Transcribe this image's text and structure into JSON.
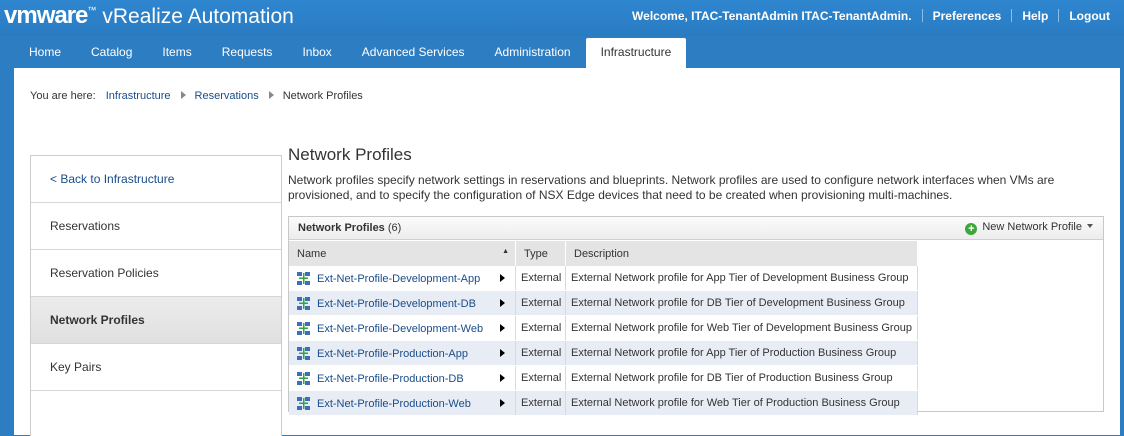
{
  "brand": {
    "logo": "vmware",
    "product": "vRealize Automation"
  },
  "header_links": {
    "welcome": "Welcome, ITAC-TenantAdmin ITAC-TenantAdmin.",
    "preferences": "Preferences",
    "help": "Help",
    "logout": "Logout"
  },
  "nav": {
    "tabs": [
      {
        "label": "Home"
      },
      {
        "label": "Catalog"
      },
      {
        "label": "Items"
      },
      {
        "label": "Requests"
      },
      {
        "label": "Inbox"
      },
      {
        "label": "Advanced Services"
      },
      {
        "label": "Administration"
      },
      {
        "label": "Infrastructure"
      }
    ],
    "active": "Infrastructure"
  },
  "breadcrumb": {
    "prefix": "You are here:",
    "items": [
      "Infrastructure",
      "Reservations",
      "Network Profiles"
    ]
  },
  "sidebar": {
    "items": [
      {
        "label": "< Back to Infrastructure"
      },
      {
        "label": "Reservations"
      },
      {
        "label": "Reservation Policies"
      },
      {
        "label": "Network Profiles"
      },
      {
        "label": "Key Pairs"
      }
    ],
    "active": "Network Profiles"
  },
  "page": {
    "title": "Network Profiles",
    "description": "Network profiles specify network settings in reservations and blueprints. Network profiles are used to configure network interfaces when VMs are provisioned, and to specify the configuration of NSX Edge devices that need to be created when provisioning multi-machines."
  },
  "grid": {
    "title": "Network Profiles",
    "count": "(6)",
    "new_button": "New Network Profile",
    "columns": [
      "Name",
      "Type",
      "Description"
    ],
    "sort_indicator": "▲",
    "rows": [
      {
        "name": "Ext-Net-Profile-Development-App",
        "type": "External",
        "description": "External Network profile for App Tier of Development Business Group"
      },
      {
        "name": "Ext-Net-Profile-Development-DB",
        "type": "External",
        "description": "External Network profile for DB Tier of Development Business Group"
      },
      {
        "name": "Ext-Net-Profile-Development-Web",
        "type": "External",
        "description": "External Network profile for Web Tier of Development Business Group"
      },
      {
        "name": "Ext-Net-Profile-Production-App",
        "type": "External",
        "description": "External Network profile for App Tier of Production Business Group"
      },
      {
        "name": "Ext-Net-Profile-Production-DB",
        "type": "External",
        "description": "External Network profile for DB Tier of Production Business Group"
      },
      {
        "name": "Ext-Net-Profile-Production-Web",
        "type": "External",
        "description": "External Network profile for Web Tier of Production Business Group"
      }
    ]
  },
  "icons": {
    "network_profile": "network-icon",
    "add": "plus-circle-icon",
    "dropdown": "caret-down-icon",
    "row_menu": "caret-right-icon",
    "breadcrumb_sep": "caret-right-icon"
  },
  "colors": {
    "header_blue": "#2e86cf",
    "link_blue": "#1a4c8a",
    "row_stripe": "#e8edf5",
    "add_green": "#3fa63a"
  }
}
